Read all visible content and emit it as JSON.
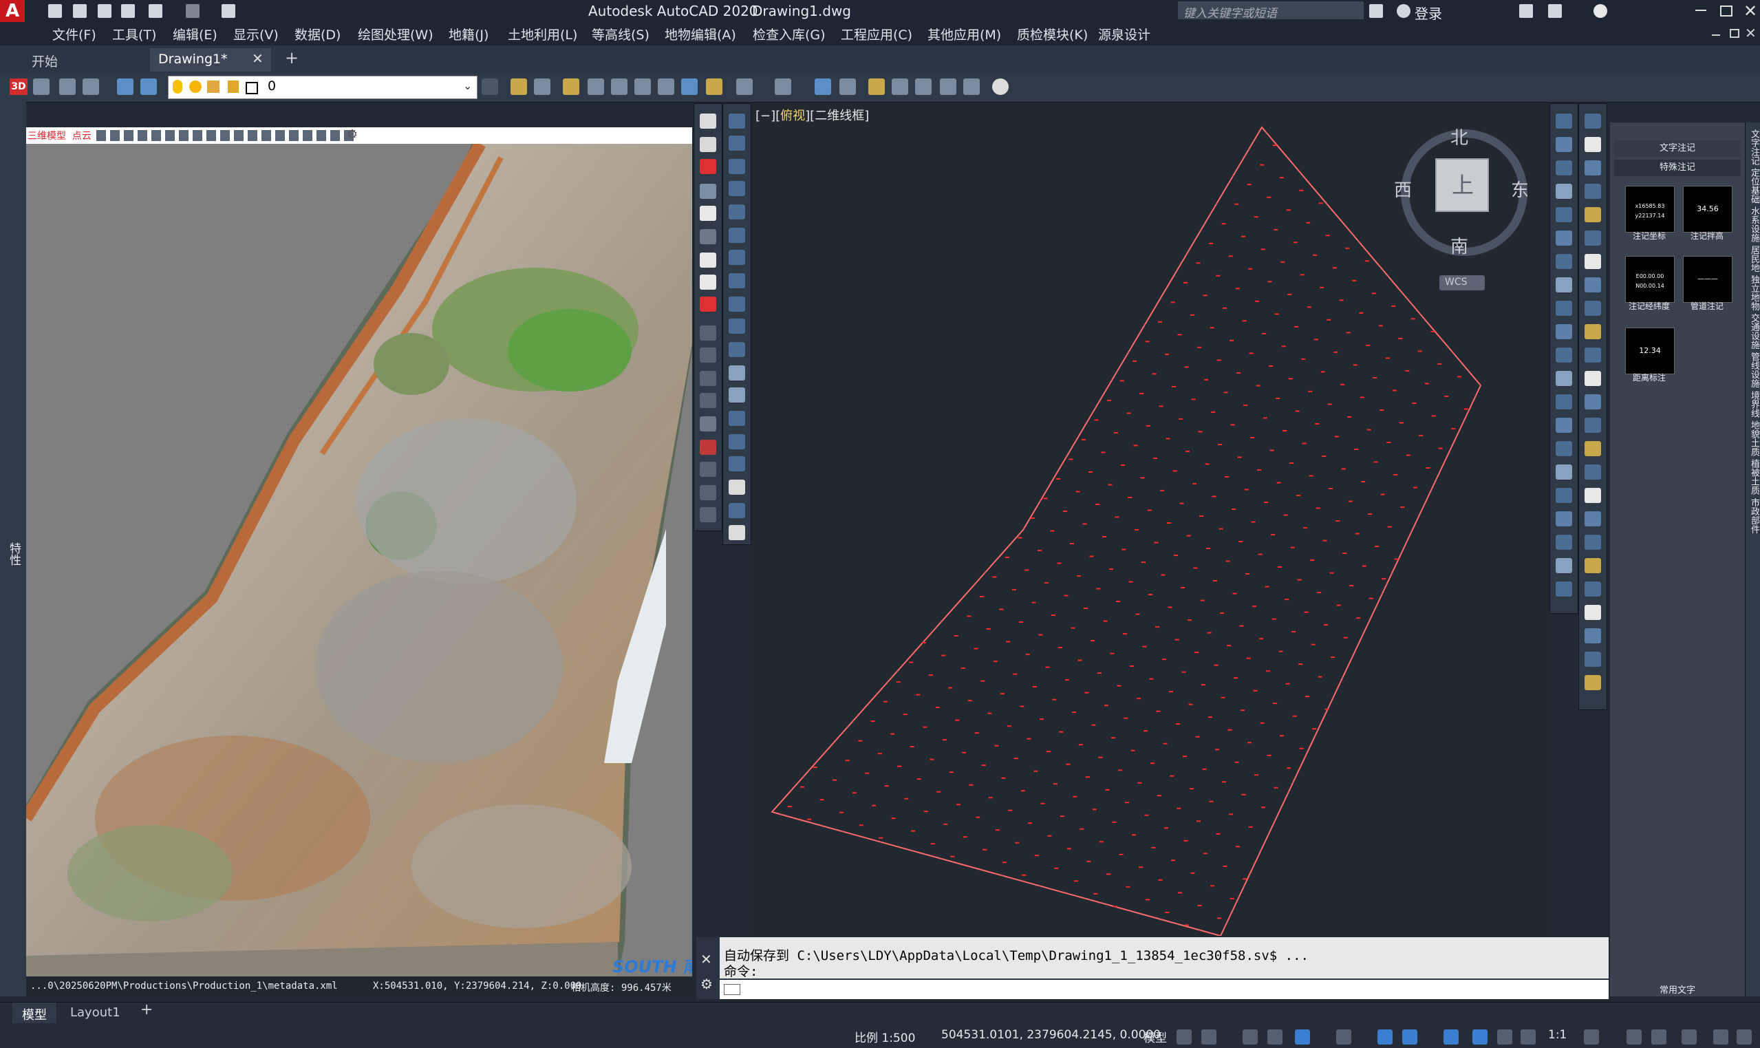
{
  "app": {
    "title": "Autodesk AutoCAD 2020",
    "file": "Drawing1.dwg",
    "logo": "A",
    "search_placeholder": "键入关键字或短语",
    "login": "登录"
  },
  "menu": [
    "文件(F)",
    "工具(T)",
    "编辑(E)",
    "显示(V)",
    "数据(D)",
    "绘图处理(W)",
    "地籍(J)",
    "土地利用(L)",
    "等高线(S)",
    "地物编辑(A)",
    "检查入库(G)",
    "工程应用(C)",
    "其他应用(M)",
    "质检模块(K)",
    "源泉设计"
  ],
  "tabs": [
    {
      "label": "开始"
    },
    {
      "label": "Drawing1*",
      "active": true
    }
  ],
  "toolbar": {
    "layer_value": "0"
  },
  "left_strip": {
    "label": "特性"
  },
  "ortho": {
    "toolbar_labels": "三维模型  点云",
    "status_path": "...0\\20250620PM\\Productions\\Production_1\\metadata.xml",
    "status_coords": "X:504531.010, Y:2379604.214, Z:0.000",
    "status_height": "相机高度: 996.457米",
    "watermark": "SOUTH 南方数码"
  },
  "drawing": {
    "view_label_prefix": "[−][",
    "view_label_view": "俯视",
    "view_label_suffix": "][二维线框]",
    "boundary_color": "#ff6b6b",
    "point_color": "#ff2a2a"
  },
  "viewcube": {
    "north": "北",
    "south": "南",
    "east": "东",
    "west": "西",
    "top": "上",
    "wcs": "WCS"
  },
  "palette": {
    "tab1": "文字注记",
    "tab2": "特殊注记",
    "cards": [
      {
        "preview": "x16585.83 y22137.14",
        "label": "注记坐标"
      },
      {
        "preview": "34.56",
        "label": "注记拌高"
      },
      {
        "preview": "E00.00.00 N00.00.14",
        "label": "注记经纬度"
      },
      {
        "preview": "———",
        "label": "管道注记"
      },
      {
        "preview": "12.34",
        "label": "距离标注"
      }
    ],
    "footer": "常用文字",
    "side_labels": "文字注记 定位基础 水系设施 居民地 独立地物 交通设施 管线设施 境界线 地貌土质 植被土质 市政部件"
  },
  "command": {
    "line1": "自动保存到 C:\\Users\\LDY\\AppData\\Local\\Temp\\Drawing1_1_13854_1ec30f58.sv$ ...",
    "line2": "命令:"
  },
  "layouts": [
    {
      "label": "模型",
      "active": true
    },
    {
      "label": "Layout1"
    }
  ],
  "status": {
    "scale": "比例  1:500",
    "coords": "504531.0101, 2379604.2145, 0.0000",
    "model": "模型",
    "zoom": "1:1"
  }
}
